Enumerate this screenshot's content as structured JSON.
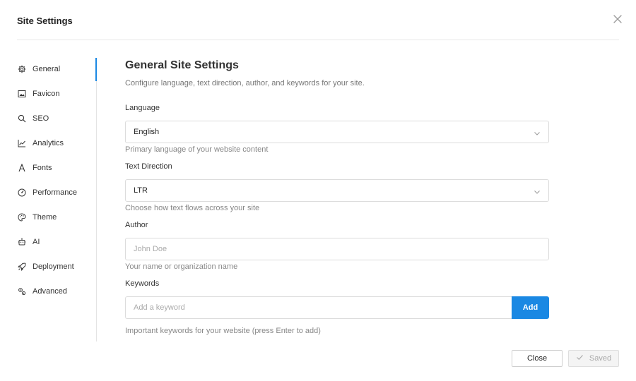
{
  "dialog": {
    "title": "Site Settings",
    "close_icon": "close-icon"
  },
  "sidebar": {
    "items": [
      {
        "label": "General",
        "icon": "gear-icon",
        "active": true
      },
      {
        "label": "Favicon",
        "icon": "image-icon"
      },
      {
        "label": "SEO",
        "icon": "search-icon"
      },
      {
        "label": "Analytics",
        "icon": "chart-line-icon"
      },
      {
        "label": "Fonts",
        "icon": "font-icon"
      },
      {
        "label": "Performance",
        "icon": "gauge-icon"
      },
      {
        "label": "Theme",
        "icon": "palette-icon"
      },
      {
        "label": "AI",
        "icon": "robot-icon"
      },
      {
        "label": "Deployment",
        "icon": "rocket-icon"
      },
      {
        "label": "Advanced",
        "icon": "cogs-icon"
      }
    ]
  },
  "main": {
    "heading": "General Site Settings",
    "description": "Configure language, text direction, author, and keywords for your site.",
    "language": {
      "label": "Language",
      "value": "English",
      "help": "Primary language of your website content"
    },
    "direction": {
      "label": "Text Direction",
      "value": "LTR",
      "help": "Choose how text flows across your site"
    },
    "author": {
      "label": "Author",
      "value": "",
      "placeholder": "John Doe",
      "help": "Your name or organization name"
    },
    "keywords": {
      "label": "Keywords",
      "value": "",
      "placeholder": "Add a keyword",
      "add_label": "Add",
      "help": "Important keywords for your website (press Enter to add)"
    }
  },
  "footer": {
    "close_label": "Close",
    "saved_label": "Saved"
  },
  "colors": {
    "accent": "#1a88e3"
  }
}
